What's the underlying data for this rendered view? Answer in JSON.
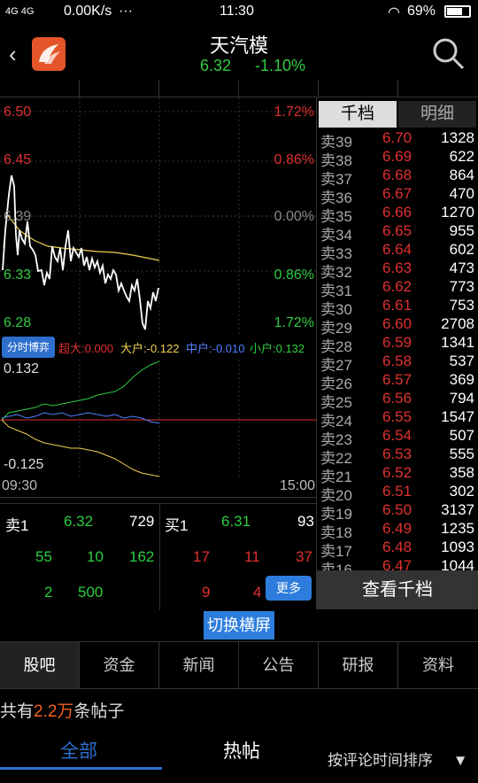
{
  "statusbar": {
    "network": "4G 4G",
    "speed": "0.00K/s",
    "dots": "···",
    "time": "11:30",
    "battery": "69%"
  },
  "header": {
    "back_icon": "chevron-left-icon",
    "logo_icon": "app-logo-icon",
    "title": "天汽模",
    "price": "6.32",
    "change": "-1.10%",
    "search_icon": "search-icon"
  },
  "chart": {
    "price_labels": [
      {
        "price": "6.50",
        "pct": "1.72%",
        "color": "red"
      },
      {
        "price": "6.45",
        "pct": "0.86%",
        "color": "red"
      },
      {
        "price": "6.39",
        "pct": "0.00%",
        "color": "gray"
      },
      {
        "price": "6.33",
        "pct": "0.86%",
        "color": "green"
      },
      {
        "price": "6.28",
        "pct": "1.72%",
        "color": "green"
      }
    ],
    "legend_button": "分时博弈",
    "legend": [
      {
        "label": "超大:0.000",
        "color": "red"
      },
      {
        "label": "大户:-0.122",
        "color": "yellow"
      },
      {
        "label": "中户:-0.010",
        "color": "blue"
      },
      {
        "label": "小户:0.132",
        "color": "green"
      }
    ],
    "sub_top": "0.132",
    "sub_bottom": "-0.125",
    "time_start": "09:30",
    "time_end": "15:00"
  },
  "bidask": {
    "sell_label": "卖1",
    "sell_price": "6.32",
    "sell_vol": "729",
    "buy_label": "买1",
    "buy_price": "6.31",
    "buy_vol": "93",
    "row2_left": [
      "55",
      "10",
      "162"
    ],
    "row2_right": [
      "17",
      "11",
      "37"
    ],
    "row3_left": [
      "2",
      "500"
    ],
    "row3_right": [
      "9",
      "4"
    ],
    "more_button": "更多"
  },
  "book": {
    "tabs": [
      "千档",
      "明细"
    ],
    "rows": [
      {
        "lv": "卖39",
        "pr": "6.70",
        "vol": "1328"
      },
      {
        "lv": "卖38",
        "pr": "6.69",
        "vol": "622"
      },
      {
        "lv": "卖37",
        "pr": "6.68",
        "vol": "864"
      },
      {
        "lv": "卖36",
        "pr": "6.67",
        "vol": "470"
      },
      {
        "lv": "卖35",
        "pr": "6.66",
        "vol": "1270"
      },
      {
        "lv": "卖34",
        "pr": "6.65",
        "vol": "955"
      },
      {
        "lv": "卖33",
        "pr": "6.64",
        "vol": "602"
      },
      {
        "lv": "卖32",
        "pr": "6.63",
        "vol": "473"
      },
      {
        "lv": "卖31",
        "pr": "6.62",
        "vol": "773"
      },
      {
        "lv": "卖30",
        "pr": "6.61",
        "vol": "753"
      },
      {
        "lv": "卖29",
        "pr": "6.60",
        "vol": "2708"
      },
      {
        "lv": "卖28",
        "pr": "6.59",
        "vol": "1341"
      },
      {
        "lv": "卖27",
        "pr": "6.58",
        "vol": "537"
      },
      {
        "lv": "卖26",
        "pr": "6.57",
        "vol": "369"
      },
      {
        "lv": "卖25",
        "pr": "6.56",
        "vol": "794"
      },
      {
        "lv": "卖24",
        "pr": "6.55",
        "vol": "1547"
      },
      {
        "lv": "卖23",
        "pr": "6.54",
        "vol": "507"
      },
      {
        "lv": "卖22",
        "pr": "6.53",
        "vol": "555"
      },
      {
        "lv": "卖21",
        "pr": "6.52",
        "vol": "358"
      },
      {
        "lv": "卖20",
        "pr": "6.51",
        "vol": "302"
      },
      {
        "lv": "卖19",
        "pr": "6.50",
        "vol": "3137"
      },
      {
        "lv": "卖18",
        "pr": "6.49",
        "vol": "1235"
      },
      {
        "lv": "卖17",
        "pr": "6.48",
        "vol": "1093"
      },
      {
        "lv": "卖16",
        "pr": "6.47",
        "vol": "1044"
      }
    ],
    "view_button": "查看千档"
  },
  "landscape_button": "切换横屏",
  "nav_tabs": [
    "股吧",
    "资金",
    "新闻",
    "公告",
    "研报",
    "资料"
  ],
  "posts": {
    "prefix": "共有",
    "count": "2.2万",
    "suffix": "条帖子"
  },
  "filters": {
    "all": "全部",
    "hot": "热帖",
    "sort": "按评论时间排序",
    "sort_icon": "caret-down-icon"
  },
  "colors": {
    "up": "#e03030",
    "down": "#2ecc40",
    "accent": "#2e7ddc",
    "avg_line": "#f0d050"
  }
}
